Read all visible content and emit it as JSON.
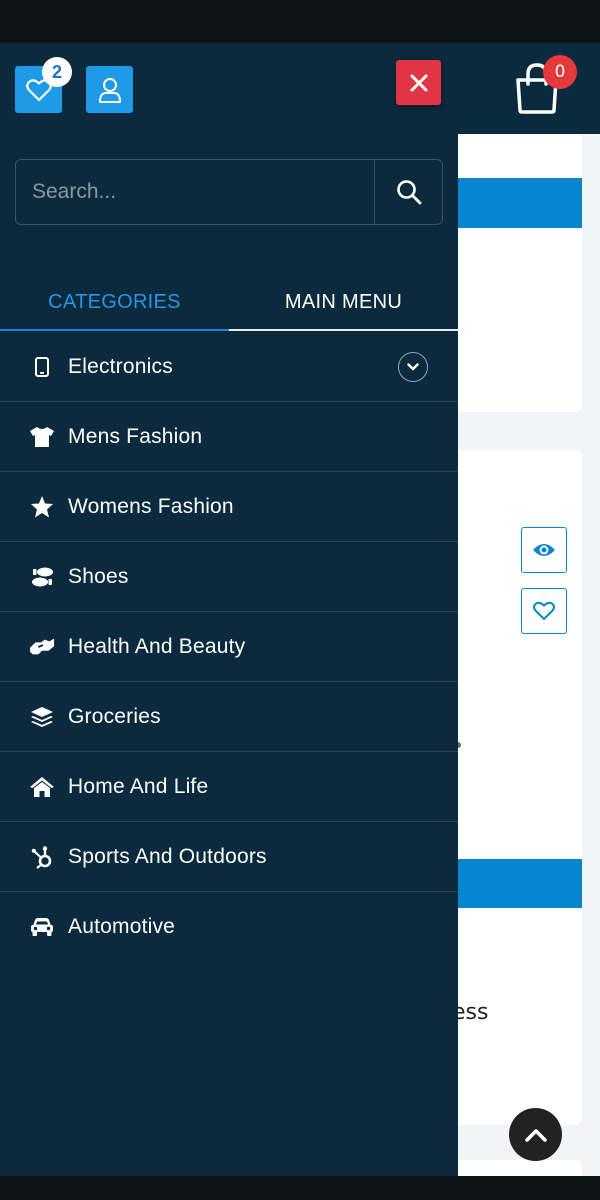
{
  "header": {
    "wishlist_count": "2",
    "cart_count": "0"
  },
  "search": {
    "placeholder": "Search..."
  },
  "tabs": [
    {
      "label": "CATEGORIES",
      "active": true
    },
    {
      "label": "MAIN MENU",
      "active": false
    }
  ],
  "categories": [
    {
      "label": "Electronics",
      "icon": "mobile-icon",
      "expandable": true
    },
    {
      "label": "Mens Fashion",
      "icon": "tshirt-icon"
    },
    {
      "label": "Womens Fashion",
      "icon": "star-icon"
    },
    {
      "label": "Shoes",
      "icon": "shoe-prints-icon"
    },
    {
      "label": "Health And Beauty",
      "icon": "hands-helping-icon"
    },
    {
      "label": "Groceries",
      "icon": "layers-icon"
    },
    {
      "label": "Home And Life",
      "icon": "home-icon"
    },
    {
      "label": "Sports And Outdoors",
      "icon": "hubspot-icon"
    },
    {
      "label": "Automotive",
      "icon": "car-icon"
    }
  ],
  "background_page": {
    "text_fragment": "ess"
  },
  "colors": {
    "drawer_bg": "#0c2a3e",
    "accent": "#1e9be6",
    "close": "#df3545",
    "brand_blue": "#0586cf"
  }
}
